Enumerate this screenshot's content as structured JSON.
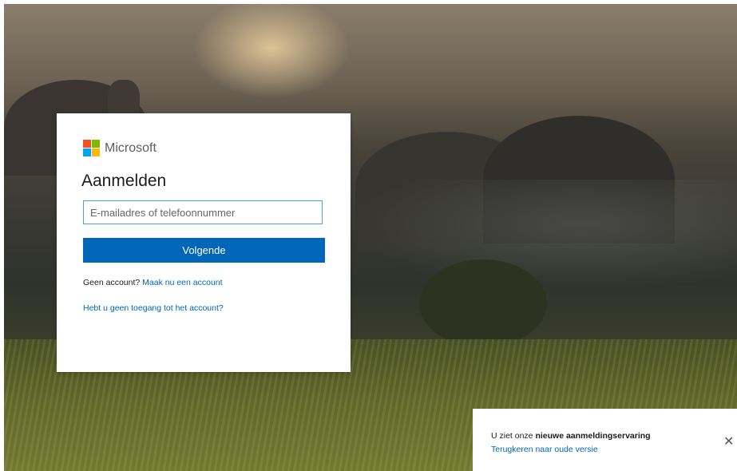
{
  "brand": {
    "logo_text": "Microsoft"
  },
  "signin": {
    "title": "Aanmelden",
    "email_placeholder": "E-mailadres of telefoonnummer",
    "email_value": "",
    "next_label": "Volgende",
    "no_account_text": "Geen account?",
    "create_account_link": "Maak nu een account",
    "no_access_link": "Hebt u geen toegang tot het account?"
  },
  "banner": {
    "text_prefix": "U ziet onze",
    "text_bold": "nieuwe aanmeldingservaring",
    "revert_link": "Terugkeren naar oude versie",
    "close_icon": "✕"
  },
  "colors": {
    "primary": "#0067b8",
    "ms_red": "#f25022",
    "ms_green": "#7fba00",
    "ms_blue": "#00a4ef",
    "ms_yellow": "#ffb900"
  }
}
